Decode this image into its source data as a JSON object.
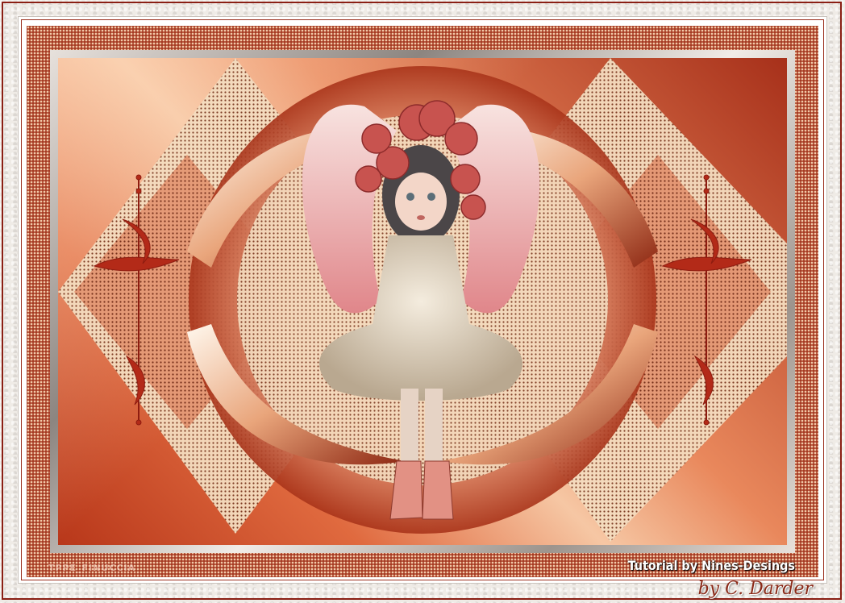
{
  "artwork": {
    "subject": "doll-girl-with-rose-crown",
    "palette": {
      "accent": "#b8371a",
      "peach": "#f6c7a4",
      "cream": "#f3e3c8",
      "frame_dots": "#a63b23"
    }
  },
  "text": {
    "watermark": "TPPE_FINUCCIA",
    "credit": "Tutorial by Nines-Desings",
    "signature": "by C. Darder"
  }
}
